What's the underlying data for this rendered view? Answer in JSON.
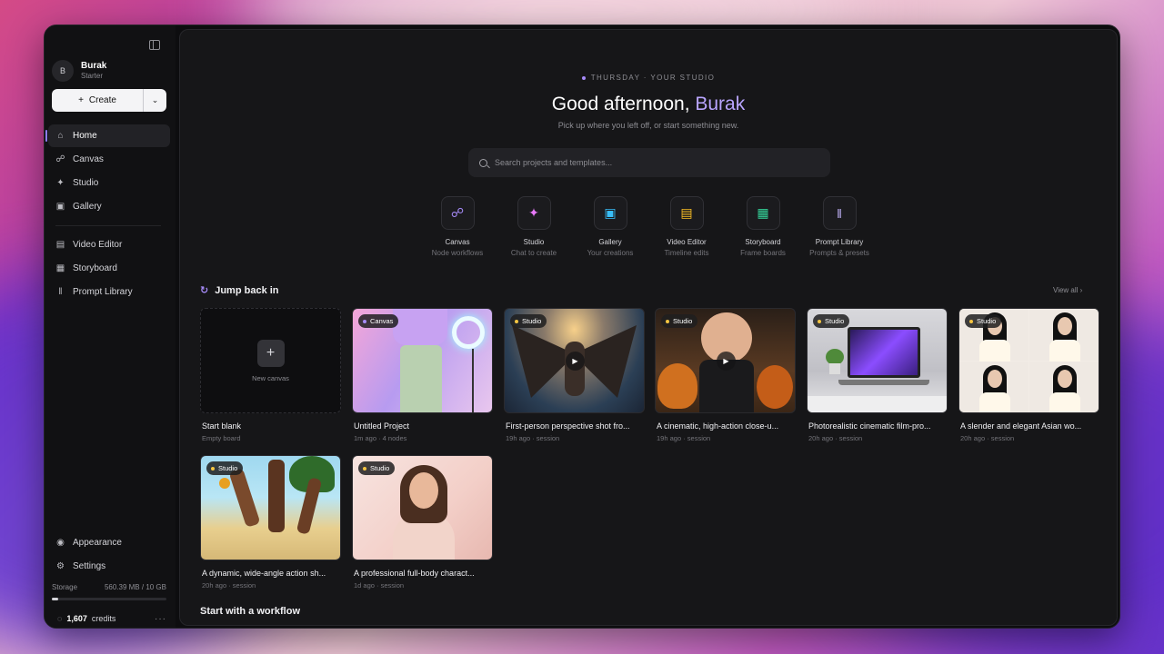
{
  "sidebar": {
    "user": {
      "initial": "B",
      "name": "Burak",
      "plan": "Starter"
    },
    "create_label": "Create",
    "nav_primary": [
      {
        "label": "Home",
        "icon": "home-icon",
        "active": true
      },
      {
        "label": "Canvas",
        "icon": "nodes-icon"
      },
      {
        "label": "Studio",
        "icon": "wand-icon"
      },
      {
        "label": "Gallery",
        "icon": "image-icon"
      }
    ],
    "nav_secondary": [
      {
        "label": "Video Editor",
        "icon": "clapper-icon"
      },
      {
        "label": "Storyboard",
        "icon": "layout-icon"
      },
      {
        "label": "Prompt Library",
        "icon": "library-icon"
      }
    ],
    "nav_bottom": [
      {
        "label": "Appearance",
        "icon": "palette-icon"
      },
      {
        "label": "Settings",
        "icon": "gear-icon"
      }
    ],
    "storage": {
      "label": "Storage",
      "value": "560.39 MB / 10 GB",
      "fraction": 0.055
    },
    "credits": {
      "value": "1,607",
      "label": "credits"
    }
  },
  "header": {
    "eyebrow": "THURSDAY · YOUR STUDIO",
    "greeting": "Good afternoon, ",
    "name": "Burak",
    "subtitle": "Pick up where you left off, or start something new."
  },
  "search": {
    "placeholder": "Search projects and templates..."
  },
  "quick_actions": [
    {
      "title": "Canvas",
      "sub": "Node workflows",
      "icon": "nodes-icon",
      "color": "#a78bfa"
    },
    {
      "title": "Studio",
      "sub": "Chat to create",
      "icon": "wand-icon",
      "color": "#e879f9"
    },
    {
      "title": "Gallery",
      "sub": "Your creations",
      "icon": "image-icon",
      "color": "#38bdf8"
    },
    {
      "title": "Video Editor",
      "sub": "Timeline edits",
      "icon": "clapper-icon",
      "color": "#fbbf24"
    },
    {
      "title": "Storyboard",
      "sub": "Frame boards",
      "icon": "layout-icon",
      "color": "#34d399"
    },
    {
      "title": "Prompt Library",
      "sub": "Prompts & presets",
      "icon": "library-icon",
      "color": "#c4b5fd"
    }
  ],
  "jump_back": {
    "title": "Jump back in",
    "view_all": "View all",
    "blank": {
      "label": "New canvas",
      "title": "Start blank",
      "meta": "Empty board"
    },
    "items": [
      {
        "badge": "Canvas",
        "badge_color": "#a78bfa",
        "title": "Untitled Project",
        "meta": "1m ago · 4 nodes",
        "video": false
      },
      {
        "badge": "Studio",
        "badge_color": "#f5c542",
        "title": "First-person perspective shot fro...",
        "meta": "19h ago · session",
        "video": true
      },
      {
        "badge": "Studio",
        "badge_color": "#f5c542",
        "title": "A cinematic, high-action close-u...",
        "meta": "19h ago · session",
        "video": true
      },
      {
        "badge": "Studio",
        "badge_color": "#f5c542",
        "title": "Photorealistic cinematic film-pro...",
        "meta": "20h ago · session",
        "video": false
      },
      {
        "badge": "Studio",
        "badge_color": "#f5c542",
        "title": "A slender and elegant Asian wo...",
        "meta": "20h ago · session",
        "video": false
      },
      {
        "badge": "Studio",
        "badge_color": "#f5c542",
        "title": "A dynamic, wide-angle action sh...",
        "meta": "20h ago · session",
        "video": false
      },
      {
        "badge": "Studio",
        "badge_color": "#f5c542",
        "title": "A professional full-body charact...",
        "meta": "1d ago · session",
        "video": false
      }
    ]
  },
  "workflow_section": {
    "title": "Start with a workflow"
  }
}
